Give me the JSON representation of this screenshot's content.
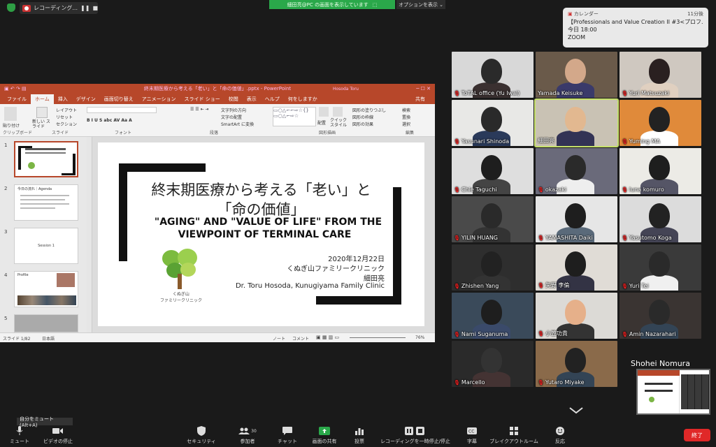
{
  "topbar": {
    "recording_label": "レコーディング...",
    "pause_icon": "pause-icon",
    "stop_icon": "stop-icon",
    "viewing_text": "細田亮@PC の画面を表示しています",
    "options_label": "オプションを表示"
  },
  "notification": {
    "app": "カレンダー",
    "time": "11分後",
    "title": "【Professionals and Value Creation II #3<プロフ...",
    "when": "今日 18:00",
    "location": "ZOOM"
  },
  "ppt": {
    "title": "終末期医療から考える「老い」と「命の価値」.pptx - PowerPoint",
    "user": "Hosoda Toru",
    "tabs": [
      "ファイル",
      "ホーム",
      "挿入",
      "デザイン",
      "画面切り替え",
      "アニメーション",
      "スライド ショー",
      "校閲",
      "表示",
      "ヘルプ",
      "何をしますか"
    ],
    "share": "共有",
    "groups": [
      "クリップボード",
      "スライド",
      "フォント",
      "段落",
      "図形描画",
      "編集"
    ],
    "buttons": {
      "paste": "貼り付け",
      "new_slide": "新しい スライド",
      "layout": "レイアウト",
      "reset": "リセット",
      "section": "セクション",
      "find": "検索",
      "replace": "置換",
      "select": "選択",
      "arrange": "配置",
      "quick_style": "クイック スタイル",
      "text_direction": "文字列の方向",
      "align_text": "文字の配置",
      "smartart": "SmartArt に変換",
      "shape_fill": "図形の塗りつぶし",
      "shape_outline": "図形の枠線",
      "shape_effects": "図形の効果"
    },
    "thumbnail_numbers": [
      "1",
      "2",
      "3",
      "4",
      "5"
    ],
    "thumb2_title": "今日の流れ｜Agenda",
    "thumb3_title": "Session 1",
    "thumb4_title": "Profile",
    "status": {
      "slide": "スライド 1/82",
      "lang": "日本語",
      "notes": "ノート",
      "comments": "コメント",
      "zoom": "76%"
    },
    "slide": {
      "title_jp_line1": "終末期医療から考える「老い」と",
      "title_jp_line2": "「命の価値」",
      "title_en_line1": "\"AGING\" AND \"VALUE OF LIFE\" FROM THE",
      "title_en_line2": "VIEWPOINT OF TERMINAL CARE",
      "date": "2020年12月22日",
      "clinic_jp": "くぬぎ山ファミリークリニック",
      "presenter_jp": "細田亮",
      "presenter_en": "Dr. Toru Hosoda, Kunugiyama Family Clinic",
      "logo_text1": "くぬぎ山",
      "logo_text2": "ファミリークリニック"
    }
  },
  "participants": [
    {
      "name": "ToTAL office (Yu Iwai)",
      "muted": true
    },
    {
      "name": "Yamada Keisuke",
      "muted": false
    },
    {
      "name": "Yuri Matsuzaki",
      "muted": true
    },
    {
      "name": "Yasunari Shinoda",
      "muted": true
    },
    {
      "name": "細田亮",
      "muted": false
    },
    {
      "name": "Yuming MA",
      "muted": true
    },
    {
      "name": "Chie Taguchi",
      "muted": true
    },
    {
      "name": "okazaki",
      "muted": true
    },
    {
      "name": "luna komuro",
      "muted": true
    },
    {
      "name": "YILIN HUANG",
      "muted": true
    },
    {
      "name": "YAMASHITA Daiki",
      "muted": true
    },
    {
      "name": "Yasutomo Koga",
      "muted": true
    },
    {
      "name": "Zhishen Yang",
      "muted": true
    },
    {
      "name": "矢野 李倫",
      "muted": true
    },
    {
      "name": "Yuri Tei",
      "muted": true
    },
    {
      "name": "Nami Suganuma",
      "muted": true
    },
    {
      "name": "小笠功貴",
      "muted": true
    },
    {
      "name": "Amin Nazarahari",
      "muted": true
    },
    {
      "name": "Marcello",
      "muted": true
    },
    {
      "name": "Yutaro Miyake",
      "muted": true
    },
    {
      "name": "Shohei Nomura",
      "muted": false
    }
  ],
  "toolbar": {
    "tooltip": "自分をミュート (Alt+A)",
    "mute": "ミュート",
    "video": "ビデオの停止",
    "security": "セキュリティ",
    "participants": "参加者",
    "participant_count": "30",
    "chat": "チャット",
    "share": "画面の共有",
    "polls": "投票",
    "recording": "レコーディングを一時停止/停止",
    "captions": "字幕",
    "breakout": "ブレイクアウトルーム",
    "reactions": "反応",
    "end": "終了"
  },
  "colors": {
    "ppt_red": "#b7472a",
    "zoom_green": "#2aa84a",
    "end_red": "#e02828",
    "active_speaker": "#c6e06a"
  }
}
